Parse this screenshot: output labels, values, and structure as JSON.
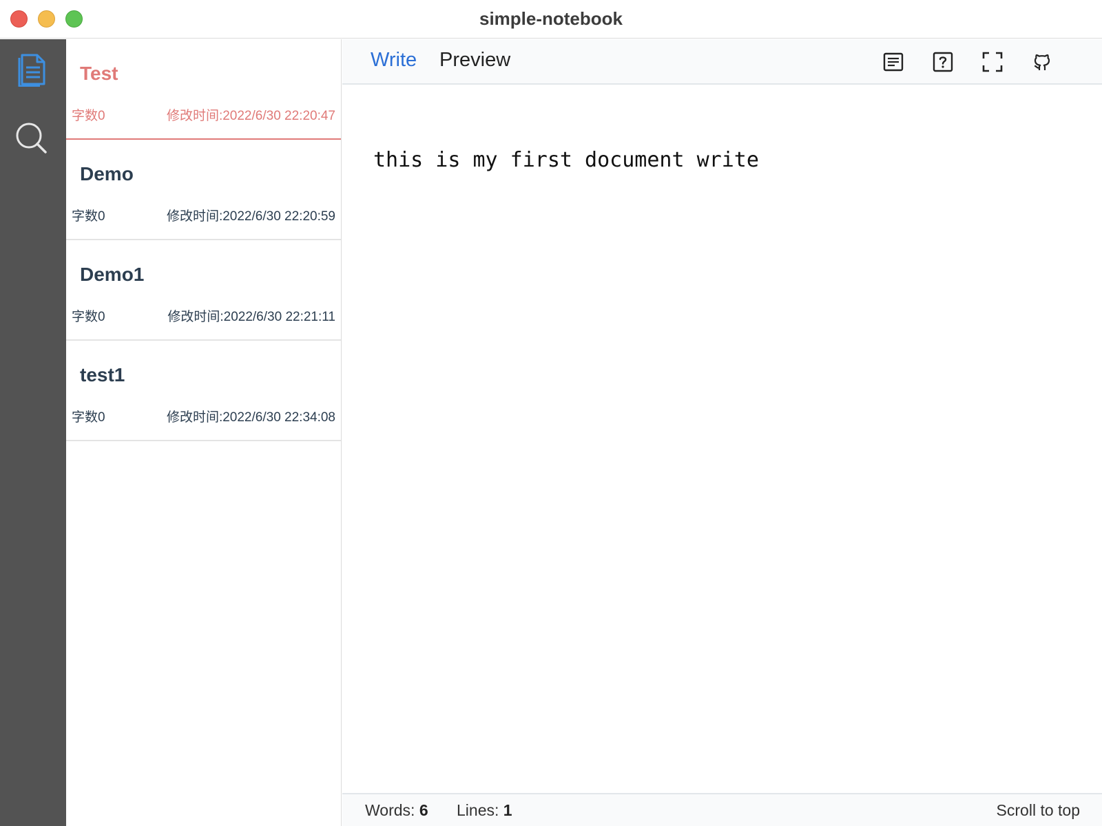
{
  "window": {
    "title": "simple-notebook"
  },
  "sidebar": {
    "items": [
      {
        "icon": "document-icon",
        "active": true
      },
      {
        "icon": "search-icon",
        "active": false
      }
    ]
  },
  "notes": [
    {
      "title": "Test",
      "word_count": "字数0",
      "modified": "修改时间:2022/6/30 22:20:47",
      "active": true
    },
    {
      "title": "Demo",
      "word_count": "字数0",
      "modified": "修改时间:2022/6/30 22:20:59",
      "active": false
    },
    {
      "title": "Demo1",
      "word_count": "字数0",
      "modified": "修改时间:2022/6/30 22:21:11",
      "active": false
    },
    {
      "title": "test1",
      "word_count": "字数0",
      "modified": "修改时间:2022/6/30 22:34:08",
      "active": false
    }
  ],
  "editor": {
    "tabs": [
      {
        "label": "Write",
        "active": true
      },
      {
        "label": "Preview",
        "active": false
      }
    ],
    "toolbar_icons": [
      "toc-icon",
      "help-icon",
      "fullscreen-icon",
      "github-icon"
    ],
    "content": "this is my first document write",
    "status": {
      "words_label": "Words:",
      "words_value": "6",
      "lines_label": "Lines:",
      "lines_value": "1",
      "scroll_to_top": "Scroll to top"
    }
  },
  "colors": {
    "accent_blue": "#2b6fd6",
    "active_note": "#e07a78",
    "rail_bg": "#535353",
    "doc_icon": "#3d8fe0"
  }
}
